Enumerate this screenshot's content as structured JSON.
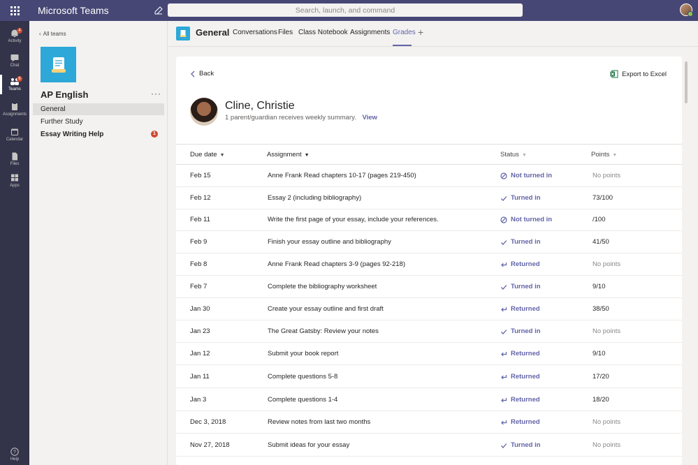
{
  "app": {
    "title": "Microsoft Teams"
  },
  "search": {
    "placeholder": "Search, launch, and command"
  },
  "rail": [
    {
      "label": "Activity",
      "badge": "4"
    },
    {
      "label": "Chat",
      "badge": ""
    },
    {
      "label": "Teams",
      "badge": "6"
    },
    {
      "label": "Assignments",
      "badge": ""
    },
    {
      "label": "Calendar",
      "badge": ""
    },
    {
      "label": "Files",
      "badge": ""
    },
    {
      "label": "Apps",
      "badge": ""
    },
    {
      "label": "Help",
      "badge": ""
    }
  ],
  "sidebar": {
    "back_label": "All teams",
    "team_name": "AP English",
    "more": "···",
    "channels": [
      {
        "label": "General"
      },
      {
        "label": "Further Study"
      },
      {
        "label": "Essay Writing Help",
        "badge": "1"
      }
    ]
  },
  "channel_header": {
    "title": "General",
    "tabs": [
      "Conversations",
      "Files",
      "Class Notebook",
      "Assignments",
      "Grades"
    ],
    "add": "+"
  },
  "grades": {
    "back_label": "Back",
    "export_label": "Export to Excel",
    "student_name": "Cline, Christie",
    "student_sub": "1 parent/guardian receives weekly summary.",
    "view_label": "View",
    "columns": {
      "due": "Due date",
      "assignment": "Assignment",
      "status": "Status",
      "points": "Points"
    },
    "rows": [
      {
        "due": "Feb 15",
        "assignment": "Anne Frank Read chapters 10-17 (pages 219-450)",
        "status": "Not turned in",
        "points": "No points"
      },
      {
        "due": "Feb 12",
        "assignment": "Essay 2 (including bibliography)",
        "status": "Turned in",
        "points": "73/100"
      },
      {
        "due": "Feb 11",
        "assignment": "Write the first page of your essay, include your references.",
        "status": "Not turned in",
        "points": "/100"
      },
      {
        "due": "Feb 9",
        "assignment": "Finish your essay outline and bibliography",
        "status": "Turned in",
        "points": "41/50"
      },
      {
        "due": "Feb 8",
        "assignment": "Anne Frank Read chapters 3-9 (pages 92-218)",
        "status": "Returned",
        "points": "No points"
      },
      {
        "due": "Feb 7",
        "assignment": "Complete the bibliography worksheet",
        "status": "Turned in",
        "points": "9/10"
      },
      {
        "due": "Jan 30",
        "assignment": "Create your essay outline and first draft",
        "status": "Returned",
        "points": "38/50"
      },
      {
        "due": "Jan 23",
        "assignment": "The Great Gatsby: Review your notes",
        "status": "Turned in",
        "points": "No points"
      },
      {
        "due": "Jan 12",
        "assignment": "Submit your book report",
        "status": "Returned",
        "points": "9/10"
      },
      {
        "due": "Jan 11",
        "assignment": "Complete questions 5-8",
        "status": "Returned",
        "points": "17/20"
      },
      {
        "due": "Jan 3",
        "assignment": "Complete questions 1-4",
        "status": "Returned",
        "points": "18/20"
      },
      {
        "due": "Dec 3, 2018",
        "assignment": "Review notes from last two months",
        "status": "Returned",
        "points": "No points"
      },
      {
        "due": "Nov 27, 2018",
        "assignment": "Submit ideas for your essay",
        "status": "Turned in",
        "points": "No points"
      }
    ]
  },
  "colors": {
    "topbar": "#464775",
    "rail": "#33344a",
    "accent": "#6264a7",
    "team": "#2da8d8",
    "badge": "#cc4a31",
    "excel": "#217346"
  }
}
